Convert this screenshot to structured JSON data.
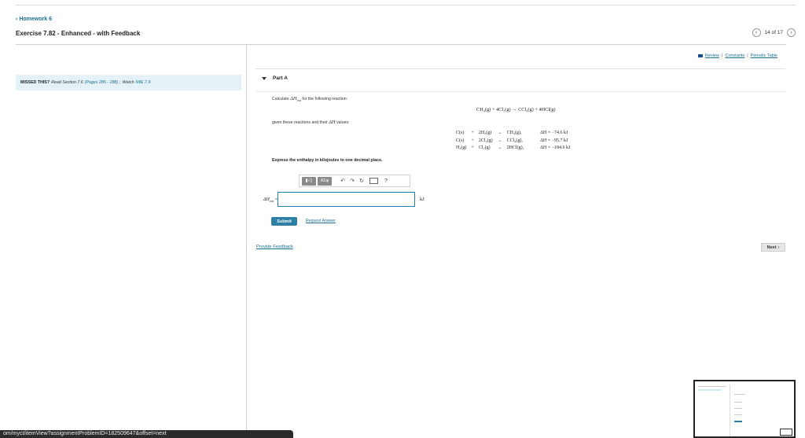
{
  "header": {
    "back_label": "Homework 6",
    "exercise_title": "Exercise 7.82 - Enhanced - with Feedback",
    "pager": "14 of 17"
  },
  "missed": {
    "label": "MISSED THIS?",
    "read": "Read Section 7.6",
    "pages": "(Pages 286 - 288)",
    "sep": ";",
    "watch": "Watch",
    "iwe": "IWE 7.9"
  },
  "resources": {
    "review": "Review",
    "constants": "Constants",
    "periodic": "Periodic Table",
    "sep": "|"
  },
  "part": {
    "label": "Part A"
  },
  "question": {
    "calc_prefix": "Calculate",
    "calc_symbol": "ΔH",
    "calc_sub": "rxn",
    "calc_suffix": "for the following reaction:",
    "main_reaction": "CH₄(g) + 4Cl₂(g) → CCl₄(g) + 4HCl(g)",
    "given_prefix": "given these reactions and their",
    "given_symbol": "ΔH",
    "given_suffix": "values:",
    "reactions": [
      {
        "r1": "C(s)",
        "plus": "+",
        "r2": "2H₂(g)",
        "arrow": "→",
        "p": "CH₄(g),",
        "dh": "ΔH = −74.6 kJ"
      },
      {
        "r1": "C(s)",
        "plus": "+",
        "r2": "2Cl₂(g)",
        "arrow": "→",
        "p": "CCl₄(g),",
        "dh": "ΔH = −95.7 kJ"
      },
      {
        "r1": "H₂(g)",
        "plus": "+",
        "r2": "Cl₂(g)",
        "arrow": "→",
        "p": "2HCl(g),",
        "dh": "ΔH = −184.6 kJ"
      }
    ],
    "express": "Express the enthalpy in kilojoules to one decimal place."
  },
  "toolbar": {
    "template": "▮√▯",
    "greek": "ΑΣφ",
    "undo": "↶",
    "redo": "↷",
    "reset": "↻",
    "help": "?"
  },
  "answer": {
    "label_symbol": "ΔH",
    "label_sub": "rxn",
    "label_eq": "=",
    "value": "",
    "unit": "kJ"
  },
  "actions": {
    "submit": "Submit",
    "request": "Request Answer",
    "feedback": "Provide Feedback",
    "next": "Next"
  },
  "status": {
    "url": "om/myct/itemView?assignmentProblemID=182509647&offset=next"
  }
}
